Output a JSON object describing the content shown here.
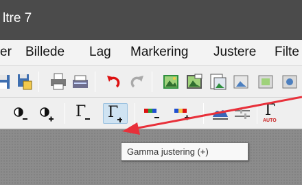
{
  "window": {
    "title": "ltre 7"
  },
  "menu": {
    "items": [
      "er",
      "Billede",
      "Lag",
      "Markering",
      "Justere",
      "Filte"
    ]
  },
  "toolbar2": {
    "gamma_minus_glyph": "Γ",
    "gamma_plus_glyph": "Γ",
    "auto_label": "AUTO"
  },
  "tooltip": {
    "text": "Gamma justering (+)"
  },
  "colors": {
    "titlebar": "#4b4b4b",
    "annotation_arrow": "#e8303a",
    "hover": "#cfe3f2"
  },
  "icons": [
    "save-icon",
    "save-as-icon",
    "print-icon",
    "scan-icon",
    "undo-icon",
    "redo-icon",
    "image-icon",
    "image-edit-icon",
    "page-icon",
    "brightness-minus-icon",
    "brightness-plus-icon",
    "gamma-minus-icon",
    "gamma-plus-icon",
    "color-balance-minus-icon",
    "color-balance-plus-icon",
    "histogram-icon",
    "levels-icon",
    "auto-gamma-icon"
  ]
}
